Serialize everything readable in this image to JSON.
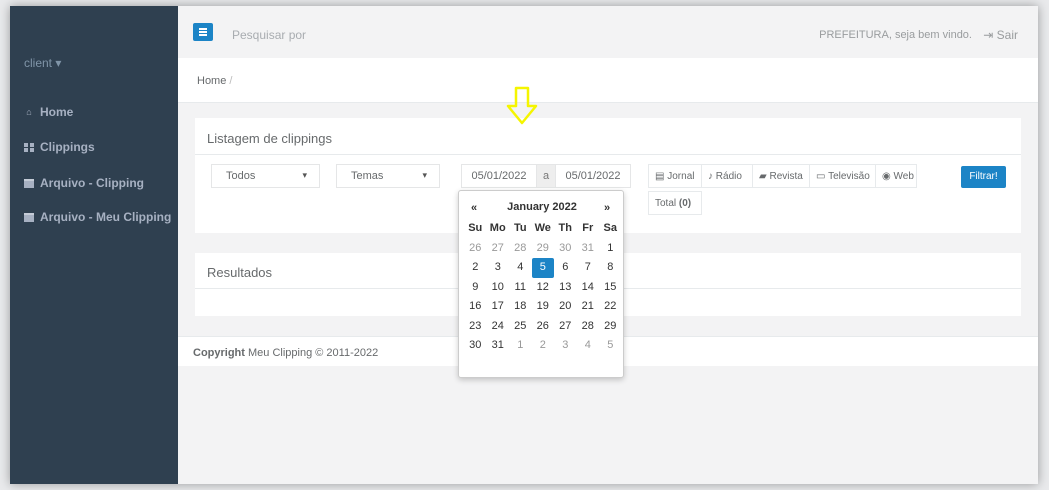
{
  "sidebar": {
    "user_label": "client ▾",
    "items": [
      {
        "label": "Home",
        "icon": "home-icon"
      },
      {
        "label": "Clippings",
        "icon": "grid-icon"
      },
      {
        "label": "Arquivo - Clipping",
        "icon": "archive-icon"
      },
      {
        "label": "Arquivo - Meu Clipping",
        "icon": "archive-icon"
      }
    ]
  },
  "topbar": {
    "search_placeholder": "Pesquisar por",
    "welcome": "PREFEITURA, seja bem vindo.",
    "logout_label": "Sair"
  },
  "breadcrumb": {
    "home": "Home",
    "separator": "/"
  },
  "listing": {
    "title": "Listagem de clippings",
    "type_select": "Todos",
    "theme_select": "Temas",
    "date_from": "05/01/2022",
    "date_separator": "a",
    "date_to": "05/01/2022",
    "media_filters": [
      "Jornal",
      "Rádio",
      "Revista",
      "Televisão",
      "Web"
    ],
    "total_label": "Total",
    "total_count": "(0)",
    "filter_button": "Filtrar!"
  },
  "results": {
    "title": "Resultados"
  },
  "footer": {
    "copyright_bold": "Copyright",
    "copyright_text": "Meu Clipping © 2011-2022"
  },
  "datepicker": {
    "prev": "«",
    "next": "»",
    "title": "January 2022",
    "weekdays": [
      "Su",
      "Mo",
      "Tu",
      "We",
      "Th",
      "Fr",
      "Sa"
    ],
    "weeks": [
      [
        "26",
        "27",
        "28",
        "29",
        "30",
        "31",
        "1"
      ],
      [
        "2",
        "3",
        "4",
        "5",
        "6",
        "7",
        "8"
      ],
      [
        "9",
        "10",
        "11",
        "12",
        "13",
        "14",
        "15"
      ],
      [
        "16",
        "17",
        "18",
        "19",
        "20",
        "21",
        "22"
      ],
      [
        "23",
        "24",
        "25",
        "26",
        "27",
        "28",
        "29"
      ],
      [
        "30",
        "31",
        "1",
        "2",
        "3",
        "4",
        "5"
      ]
    ],
    "selected_day": "5"
  },
  "colors": {
    "accent": "#1c84c6",
    "sidebar": "#2f4050",
    "arrow": "#f5f500"
  }
}
